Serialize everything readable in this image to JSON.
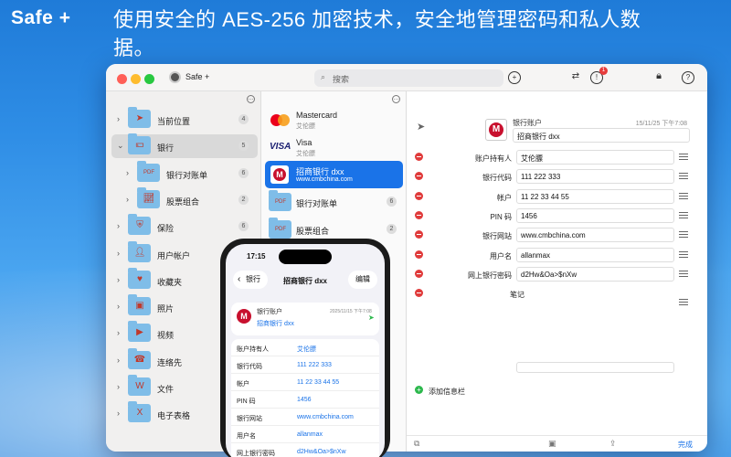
{
  "brand": "Safe +",
  "headline": "使用安全的 AES-256 加密技术，安全地管理密码和私人数据。",
  "app": {
    "name": "Safe +",
    "search_placeholder": "搜索"
  },
  "sidebar": {
    "items": [
      {
        "label": "当前位置",
        "count": "4",
        "icon": "location-arrow-icon",
        "indent": false,
        "selected": false
      },
      {
        "label": "银行",
        "count": "5",
        "icon": "money-icon",
        "indent": false,
        "selected": true,
        "expanded": true
      },
      {
        "label": "银行对账单",
        "count": "6",
        "icon": "pdf-icon",
        "indent": true,
        "selected": false
      },
      {
        "label": "股票组合",
        "count": "2",
        "icon": "pdf-chart-icon",
        "indent": true,
        "selected": false
      },
      {
        "label": "保险",
        "count": "6",
        "icon": "shield-icon",
        "indent": false,
        "selected": false
      },
      {
        "label": "用户帐户",
        "count": "",
        "icon": "user-account-icon",
        "indent": false,
        "selected": false
      },
      {
        "label": "收藏夹",
        "count": "",
        "icon": "heart-icon",
        "indent": false,
        "selected": false
      },
      {
        "label": "照片",
        "count": "",
        "icon": "photo-icon",
        "indent": false,
        "selected": false
      },
      {
        "label": "视频",
        "count": "",
        "icon": "video-icon",
        "indent": false,
        "selected": false
      },
      {
        "label": "连络先",
        "count": "",
        "icon": "contacts-icon",
        "indent": false,
        "selected": false
      },
      {
        "label": "文件",
        "count": "",
        "icon": "word-doc-icon",
        "indent": false,
        "selected": false
      },
      {
        "label": "电子表格",
        "count": "",
        "icon": "excel-sheet-icon",
        "indent": false,
        "selected": false
      }
    ]
  },
  "list": {
    "items": [
      {
        "name": "Mastercard",
        "sub": "艾伦膘",
        "logo": "mastercard-logo"
      },
      {
        "name": "Visa",
        "sub": "艾伦膘",
        "logo": "visa-logo"
      },
      {
        "name": "招商银行 dxx",
        "sub": "www.cmbchina.com",
        "logo": "cmb-logo",
        "selected": true
      },
      {
        "name": "银行对账单",
        "sub": "",
        "count": "6",
        "logo": "pdf-folder-icon"
      },
      {
        "name": "股票组合",
        "sub": "",
        "count": "2",
        "logo": "pdf-chart-folder-icon"
      }
    ]
  },
  "detail": {
    "category": "银行账户",
    "timestamp": "15/11/25 下午7:08",
    "title": "招商银行 dxx",
    "fields": [
      {
        "label": "账户持有人",
        "value": "艾伦膘"
      },
      {
        "label": "银行代码",
        "value": "111 222 333"
      },
      {
        "label": "帐户",
        "value": "11 22 33 44 55"
      },
      {
        "label": "PIN 码",
        "value": "1456"
      },
      {
        "label": "银行网站",
        "value": "www.cmbchina.com"
      },
      {
        "label": "用户名",
        "value": "allanmax"
      },
      {
        "label": "网上银行密码",
        "value": "d2Hw&Oa>$nXw"
      },
      {
        "label": "笔记",
        "value": ""
      }
    ],
    "add_field_label": "添加信息栏",
    "done_label": "完成"
  },
  "phone": {
    "time": "17:15",
    "back_label": "银行",
    "title": "招商银行 dxx",
    "edit_label": "编辑",
    "category": "银行账户",
    "timestamp": "2025/11/15 下午7:08",
    "entry_title": "招商银行 dxx",
    "fields": [
      {
        "label": "账户持有人",
        "value": "艾伦膘"
      },
      {
        "label": "银行代码",
        "value": "111 222 333"
      },
      {
        "label": "帐户",
        "value": "11 22 33 44 55"
      },
      {
        "label": "PIN 码",
        "value": "1456"
      },
      {
        "label": "银行网站",
        "value": "www.cmbchina.com"
      },
      {
        "label": "用户名",
        "value": "allanmax"
      },
      {
        "label": "网上银行密码",
        "value": "d2Hw&Oa>$nXw"
      }
    ]
  },
  "colors": {
    "accent": "#1a73e8",
    "danger": "#e03b3b",
    "add": "#2db84d",
    "bank_red": "#c8102e"
  }
}
